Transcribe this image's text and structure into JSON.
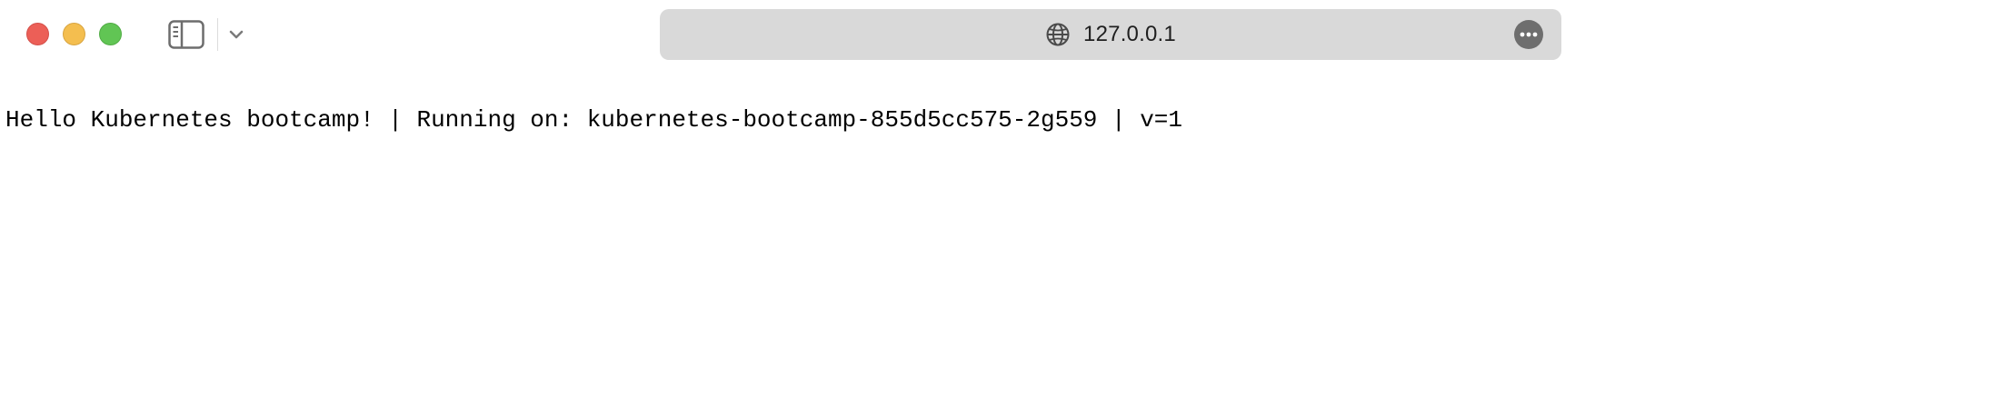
{
  "browser": {
    "window_controls": {
      "close_color": "#ec5f57",
      "minimize_color": "#f4be4f",
      "zoom_color": "#61c554"
    },
    "toolbar": {
      "sidebar_icon": "sidebar-icon",
      "chevron_icon": "chevron-down-icon"
    },
    "address_bar": {
      "icon": "globe-icon",
      "url": "127.0.0.1",
      "more_icon": "more-icon"
    }
  },
  "page": {
    "body_text": "Hello Kubernetes bootcamp! | Running on: kubernetes-bootcamp-855d5cc575-2g559 | v=1"
  }
}
